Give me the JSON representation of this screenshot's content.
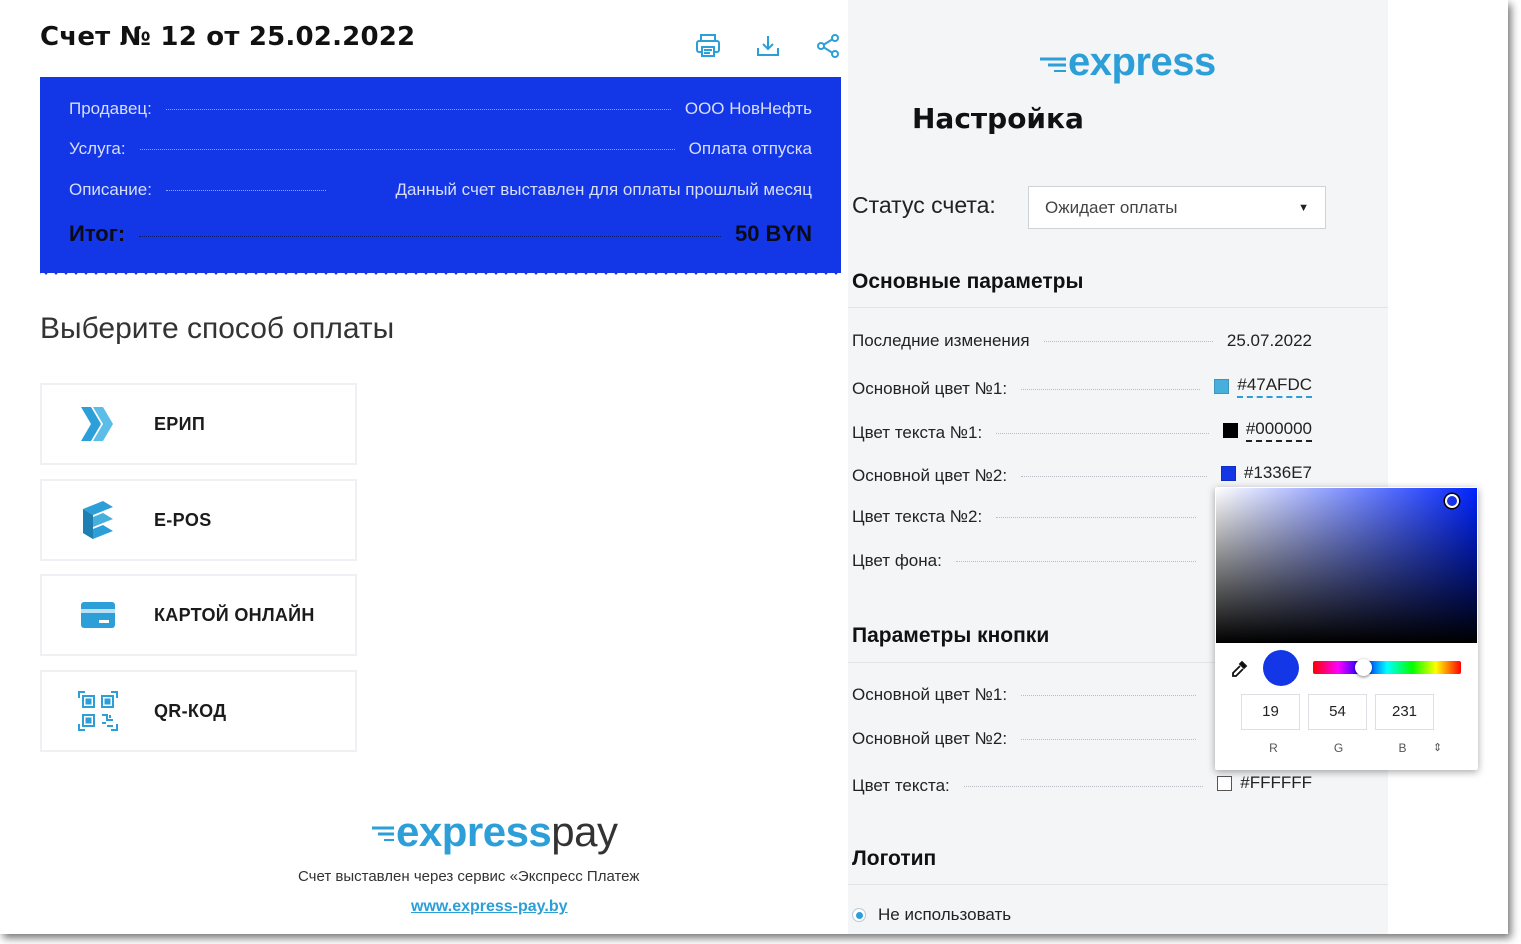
{
  "invoice": {
    "title": "Счет № 12 от 25.02.2022",
    "rows": [
      {
        "label": "Продавец:",
        "value": "ООО НовНефть"
      },
      {
        "label": "Услуга:",
        "value": "Оплата отпуска"
      },
      {
        "label": "Описание:",
        "value": "Данный счет выставлен для оплаты прошлый месяц"
      }
    ],
    "total_label": "Итог:",
    "total_value": "50 BYN",
    "card_color": "#1336E7"
  },
  "payment": {
    "heading": "Выберите способ оплаты",
    "methods": [
      {
        "label": "ЕРИП",
        "icon": "erip-icon"
      },
      {
        "label": "E-POS",
        "icon": "epos-icon"
      },
      {
        "label": "КАРТОЙ ОНЛАЙН",
        "icon": "card-icon"
      },
      {
        "label": "QR-КОД",
        "icon": "qr-code-icon"
      }
    ]
  },
  "footer": {
    "logo_part1": "express",
    "logo_part2": "pay",
    "caption": "Счет выставлен через сервис «Экспресс Платеж",
    "link": "www.express-pay.by"
  },
  "settings": {
    "logo": "express",
    "title": "Настройка",
    "status_label": "Статус счета:",
    "status_value": "Ожидает оплаты",
    "main_section": "Основные параметры",
    "main_rows": [
      {
        "label": "Последние изменения",
        "value": "25.07.2022"
      },
      {
        "label": "Основной цвет №1:",
        "value": "#47AFDC",
        "color": "#47AFDC"
      },
      {
        "label": "Цвет текста №1:",
        "value": "#000000",
        "color": "#000000"
      },
      {
        "label": "Основной цвет №2:",
        "value": "#1336E7",
        "color": "#1336E7"
      },
      {
        "label": "Цвет текста №2:"
      },
      {
        "label": "Цвет фона:"
      }
    ],
    "button_section": "Параметры кнопки",
    "button_rows": [
      {
        "label": "Основной цвет №1:"
      },
      {
        "label": "Основной цвет №2:"
      },
      {
        "label": "Цвет текста:",
        "value": "#FFFFFF",
        "color": "#FFFFFF"
      }
    ],
    "logo_section": "Логотип",
    "logo_option": "Не использовать"
  },
  "picker": {
    "r": "19",
    "g": "54",
    "b": "231",
    "r_label": "R",
    "g_label": "G",
    "b_label": "B",
    "mode_toggle": "⇕",
    "preview_color": "#1336E7"
  },
  "colors": {
    "accent": "#2d9fd8",
    "brand_blue": "#1336E7"
  }
}
